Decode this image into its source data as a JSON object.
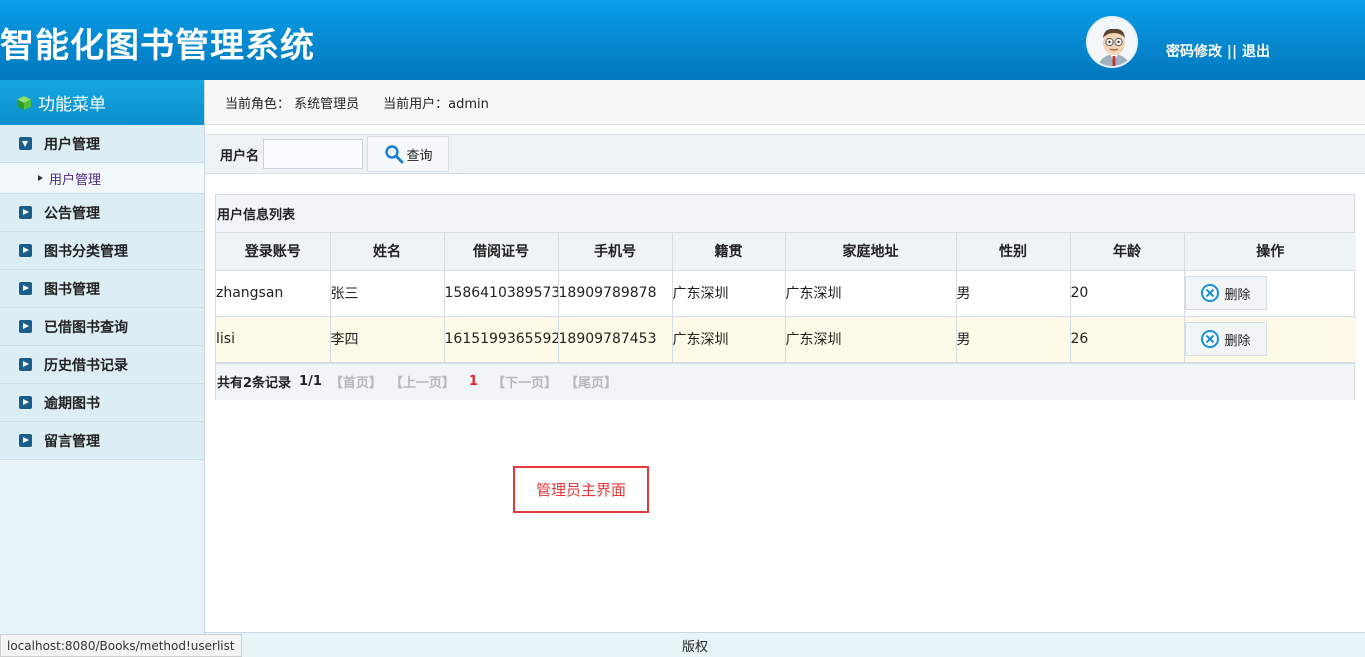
{
  "header": {
    "title": "智能化图书管理系统",
    "change_password": "密码修改",
    "separator": "||",
    "logout": "退出"
  },
  "sidebar": {
    "title": "功能菜单",
    "items": [
      {
        "label": "用户管理",
        "expanded": true,
        "sub": [
          "用户管理"
        ]
      },
      {
        "label": "公告管理"
      },
      {
        "label": "图书分类管理"
      },
      {
        "label": "图书管理"
      },
      {
        "label": "已借图书查询"
      },
      {
        "label": "历史借书记录"
      },
      {
        "label": "逾期图书"
      },
      {
        "label": "留言管理"
      }
    ]
  },
  "rolebar": {
    "role": "当前角色：  系统管理员",
    "user": "当前用户：admin"
  },
  "search": {
    "label": "用户名",
    "value": "",
    "button": "查询"
  },
  "table": {
    "title": "用户信息列表",
    "headers": [
      "登录账号",
      "姓名",
      "借阅证号",
      "手机号",
      "籍贯",
      "家庭地址",
      "性别",
      "年龄",
      "操作"
    ],
    "rows": [
      [
        "zhangsan",
        "张三",
        "1586410389573",
        "18909789878",
        "广东深圳",
        "广东深圳",
        "男",
        "20"
      ],
      [
        "lisi",
        "李四",
        "1615199365592",
        "18909787453",
        "广东深圳",
        "广东深圳",
        "男",
        "26"
      ]
    ],
    "delete_label": "删除"
  },
  "pager": {
    "count": "共有2条记录",
    "pages": "1/1",
    "first": "【首页】",
    "prev": "【上一页】",
    "current": "1",
    "next": "【下一页】",
    "last": "【尾页】"
  },
  "caption": "管理员主界面",
  "footer": "版权",
  "statusbar": "localhost:8080/Books/method!userlist",
  "colors": {
    "header": "#0587cf",
    "sidebar": "#e9f4f8",
    "caption": "#e23a3a",
    "pager_current": "#e0232c"
  }
}
